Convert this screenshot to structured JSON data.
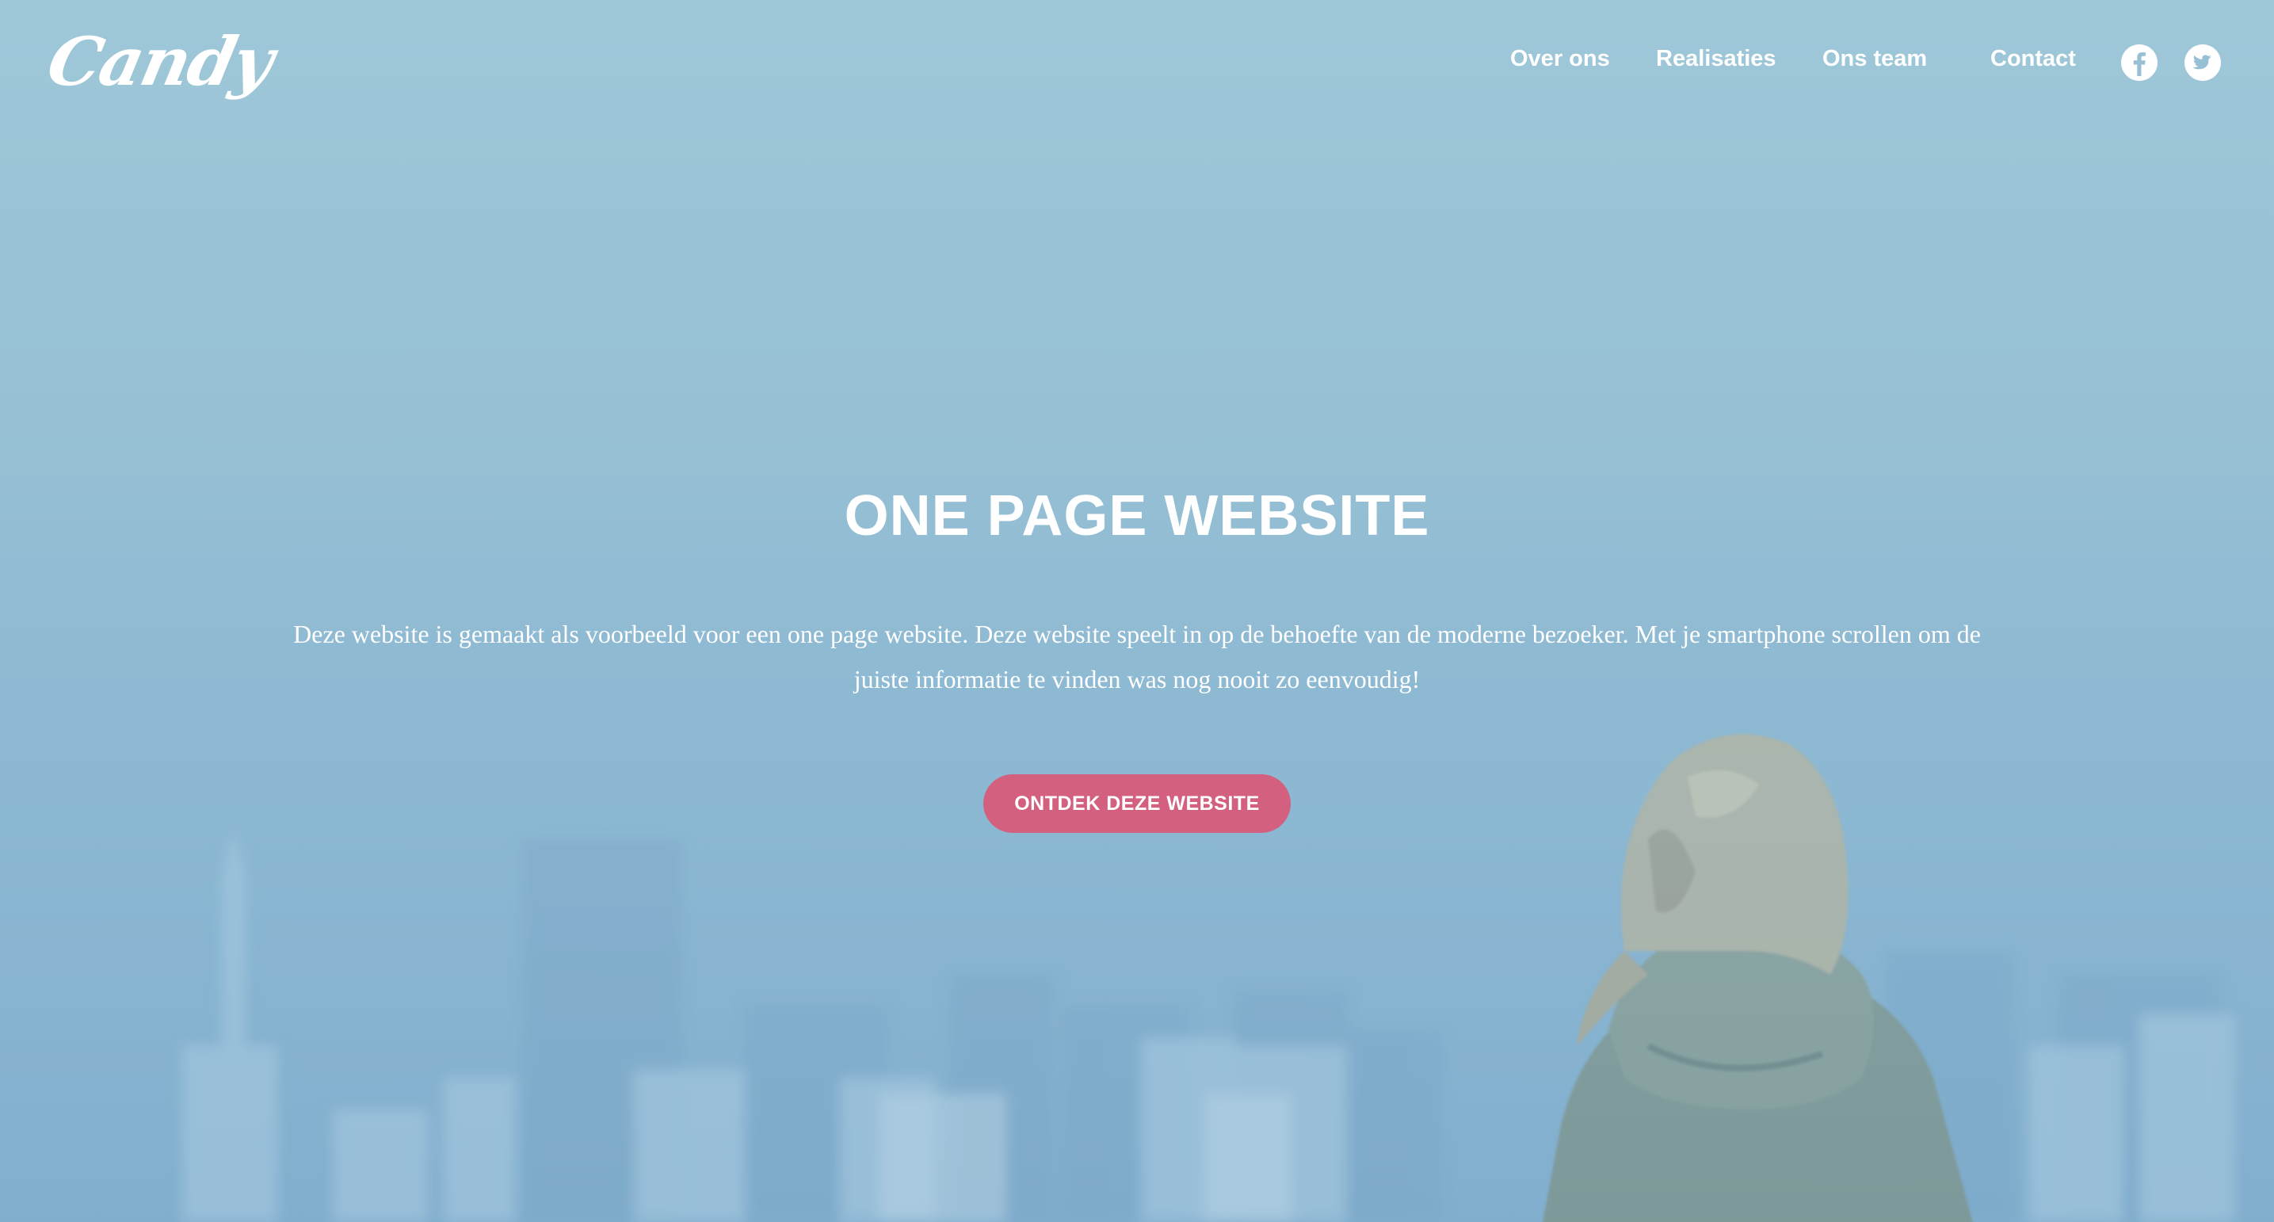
{
  "brand": {
    "logo_text": "Candy"
  },
  "nav": {
    "items": [
      {
        "label": "Over ons"
      },
      {
        "label": "Realisaties"
      },
      {
        "label": "Ons team"
      },
      {
        "label": "Contact"
      }
    ],
    "social": [
      {
        "icon": "facebook-icon"
      },
      {
        "icon": "twitter-icon"
      }
    ]
  },
  "hero": {
    "title": "ONE PAGE WEBSITE",
    "lead_line1": "Deze website is gemaakt als voorbeeld voor een one page website. Deze website speelt in op de behoefte van de moderne bezoeker. Met je smartphone scrollen om de",
    "lead_line2": "juiste informatie te vinden was nog nooit zo eenvoudig!",
    "cta_label": "ONTDEK DEZE WEBSITE"
  },
  "colors": {
    "sky": "#9ec8d8",
    "cta": "#d2607e",
    "text": "#ffffff"
  }
}
